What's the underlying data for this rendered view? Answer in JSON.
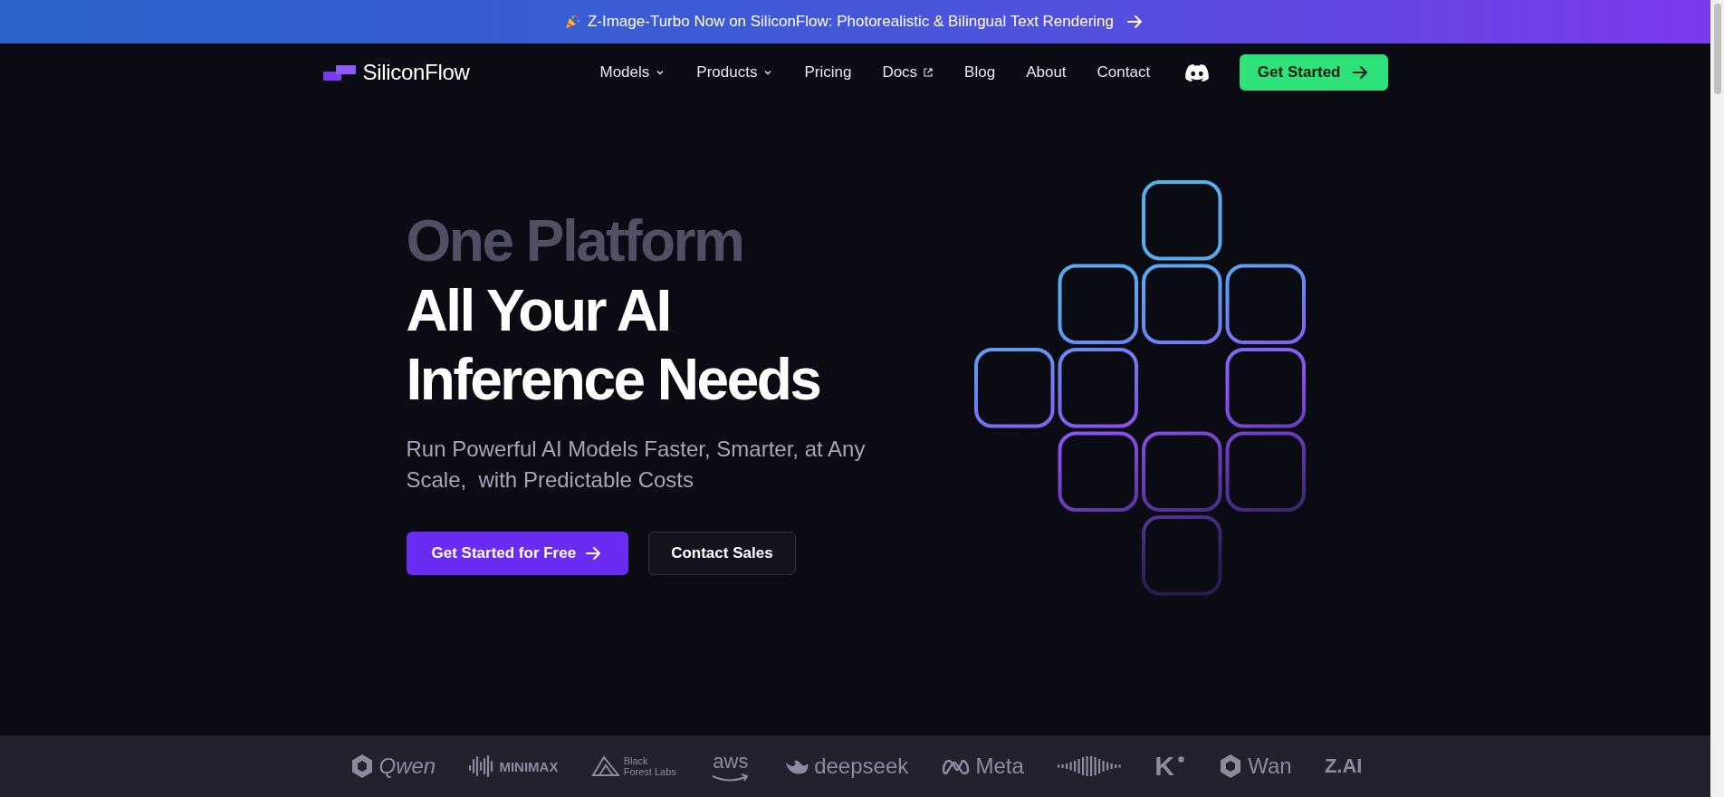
{
  "banner": {
    "text": "Z-Image-Turbo Now on SiliconFlow: Photorealistic & Bilingual Text Rendering"
  },
  "nav": {
    "brand": "SiliconFlow",
    "links": [
      {
        "label": "Models",
        "kind": "dropdown"
      },
      {
        "label": "Products",
        "kind": "dropdown"
      },
      {
        "label": "Pricing",
        "kind": "plain"
      },
      {
        "label": "Docs",
        "kind": "external"
      },
      {
        "label": "Blog",
        "kind": "plain"
      },
      {
        "label": "About",
        "kind": "plain"
      },
      {
        "label": "Contact",
        "kind": "plain"
      }
    ],
    "cta": "Get Started"
  },
  "hero": {
    "eyebrow": "One Platform",
    "title_lines": [
      "All Your AI",
      "Inference Needs"
    ],
    "subtitle": "Run Powerful AI Models Faster, Smarter, at Any Scale,  with Predictable Costs",
    "buttons": [
      {
        "label": "Get Started for Free",
        "kind": "primary"
      },
      {
        "label": "Contact Sales",
        "kind": "secondary"
      }
    ]
  },
  "partners": [
    {
      "kind": "qwen",
      "text": "Qwen"
    },
    {
      "kind": "minimax",
      "text": "MINIMAX"
    },
    {
      "kind": "bfl",
      "text": "Black Forest Labs"
    },
    {
      "kind": "aws",
      "text": "aws"
    },
    {
      "kind": "deepseek",
      "text": "deepseek"
    },
    {
      "kind": "meta",
      "text": "Meta"
    },
    {
      "kind": "wave"
    },
    {
      "kind": "k",
      "text": "K"
    },
    {
      "kind": "wan",
      "text": "Wan"
    },
    {
      "kind": "zai",
      "text": "Z.AI"
    }
  ]
}
